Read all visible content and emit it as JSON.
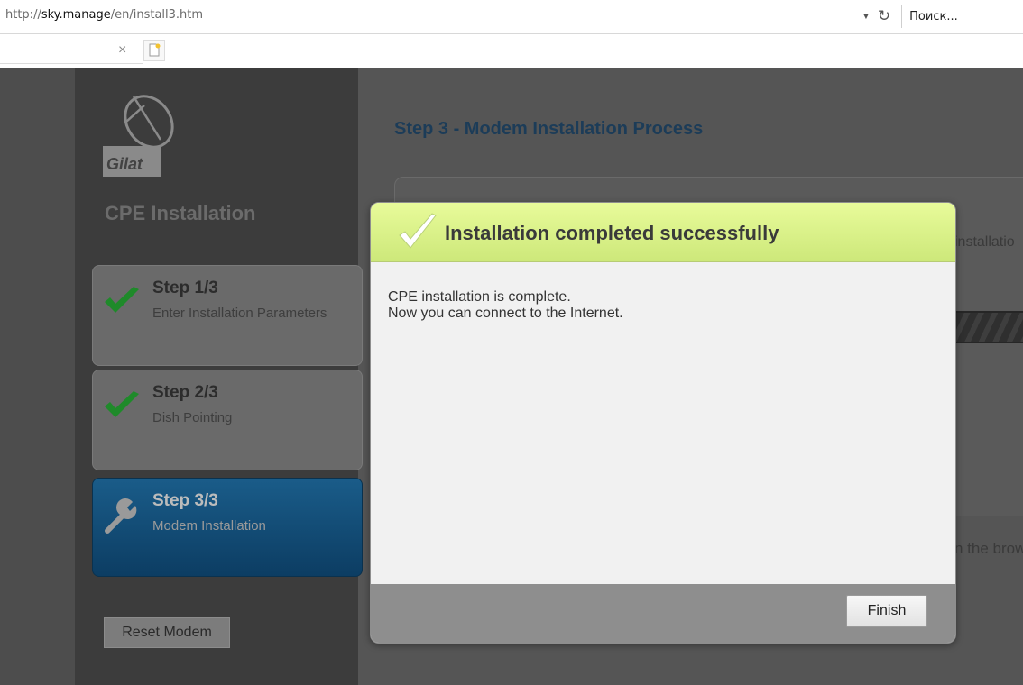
{
  "browser": {
    "url_scheme": "http://",
    "url_host": "sky.manage",
    "url_path": "/en/install3.htm",
    "search_placeholder": "Поиск..."
  },
  "sidebar": {
    "brand": "Gilat",
    "title": "CPE Installation",
    "steps": [
      {
        "title": "Step 1/3",
        "subtitle": "Enter Installation Parameters",
        "status": "done"
      },
      {
        "title": "Step 2/3",
        "subtitle": "Dish Pointing",
        "status": "done"
      },
      {
        "title": "Step 3/3",
        "subtitle": "Modem Installation",
        "status": "active"
      }
    ],
    "reset_label": "Reset Modem"
  },
  "main": {
    "title": "Step 3 - Modem Installation Process",
    "fragment_1": "installatio",
    "fragment_2": "n the brow"
  },
  "modal": {
    "title": "Installation completed successfully",
    "line1": "CPE installation is complete.",
    "line2": "Now you can connect to the Internet.",
    "finish_label": "Finish"
  },
  "colors": {
    "check_green": "#1f8a2a",
    "modal_header": "#d9f58a",
    "active_step": "#135079",
    "main_title": "#1c3c58"
  }
}
